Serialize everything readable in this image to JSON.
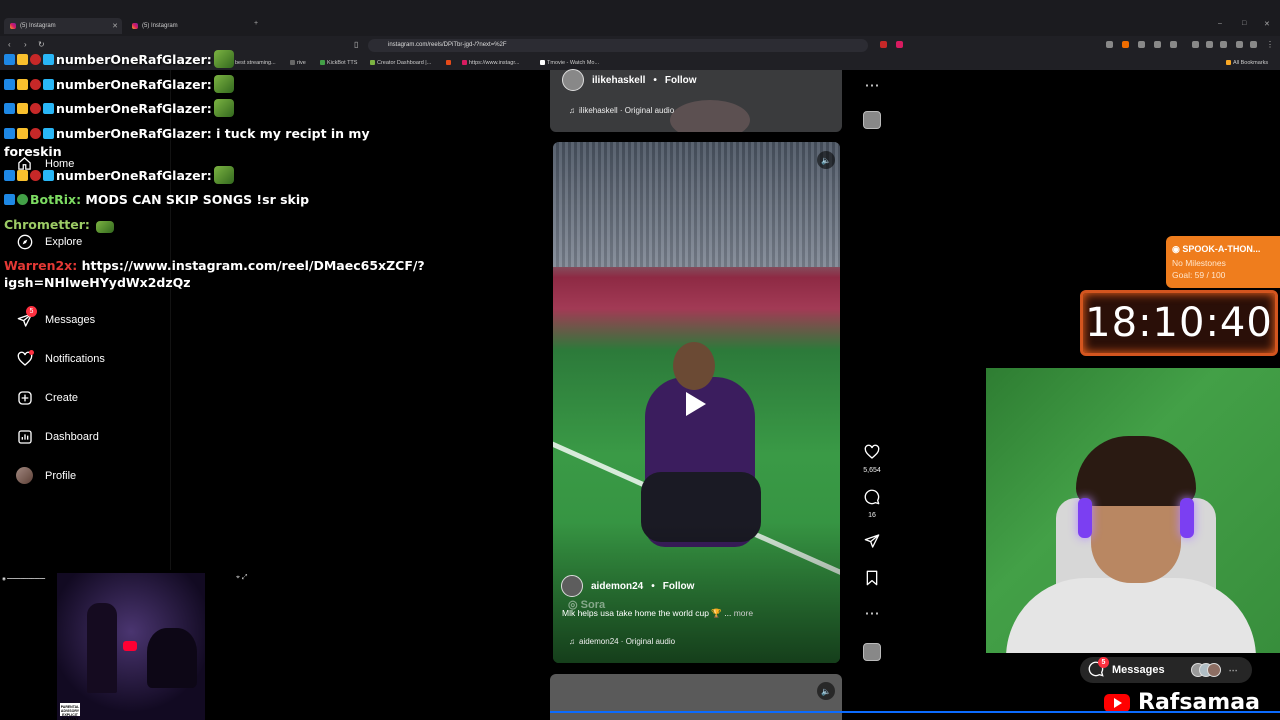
{
  "browser": {
    "tabs": [
      {
        "title": "(5) Instagram",
        "active": true
      },
      {
        "title": "(5) Instagram",
        "active": false
      }
    ],
    "url": "instagram.com/reels/DPiTbr-jgd-/?next=%2F",
    "bookmarks": [
      "best streaming...",
      "rive",
      "KickBot TTS",
      "Creator Dashboard |...",
      "https://www.instagr...",
      "Tmovie - Watch Mo..."
    ],
    "all_bookmarks": "All Bookmarks"
  },
  "sidebar": {
    "home": "Home",
    "explore": "Explore",
    "messages": "Messages",
    "messages_badge": "5",
    "notifications": "Notifications",
    "create": "Create",
    "dashboard": "Dashboard",
    "profile": "Profile"
  },
  "chat": {
    "messages": [
      {
        "user": "numberOneRafGlazer:",
        "text": ""
      },
      {
        "user": "numberOneRafGlazer:",
        "text": ""
      },
      {
        "user": "numberOneRafGlazer:",
        "text": ""
      },
      {
        "user": "numberOneRafGlazer:",
        "text": "i tuck my recipt in my"
      },
      {
        "user": "",
        "text": "foreskin"
      },
      {
        "user": "numberOneRafGlazer:",
        "text": ""
      },
      {
        "user": "BotRix:",
        "text": "MODS CAN SKIP SONGS !sr skip"
      },
      {
        "user": "Chrometter:",
        "text": ""
      },
      {
        "user": "Warren2x:",
        "text": "https://www.instagram.com/reel/DMaec65xZCF/?"
      },
      {
        "user": "",
        "text": "igsh=NHlweHYydWx2dzQz"
      }
    ]
  },
  "reels": {
    "top": {
      "username": "ilikehaskell",
      "follow": "Follow",
      "audio": "ilikehaskell · Original audio"
    },
    "main": {
      "username": "aidemon24",
      "follow": "Follow",
      "caption": "Mlk helps usa take home the world cup 🏆 ...",
      "more": "more",
      "audio": "aidemon24 · Original audio",
      "watermark": "Sora"
    },
    "actions": {
      "likes": "5,654",
      "comments": "16"
    }
  },
  "stream": {
    "subathon_title": "SPOOK-A-THON...",
    "subathon_status": "No Milestones",
    "subathon_goal": "Goal: 59 / 100",
    "timer": "18:10:40",
    "messages_label": "Messages",
    "messages_count": "5",
    "channel_name": "Rafsamaa"
  },
  "album": {
    "advisory": "PARENTAL ADVISORY EXPLICIT CONTENT"
  }
}
